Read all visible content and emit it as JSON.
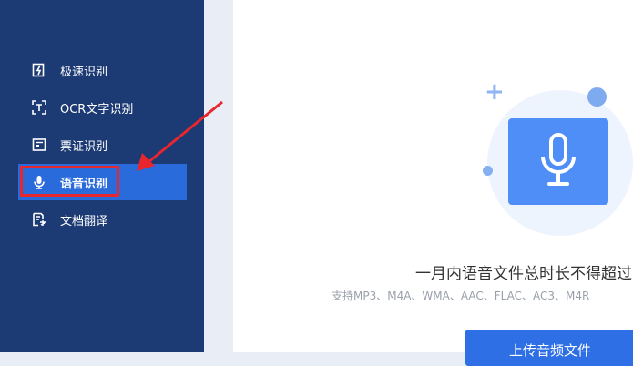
{
  "sidebar": {
    "items": [
      {
        "label": "极速识别",
        "icon": "lightning-doc-icon"
      },
      {
        "label": "OCR文字识别",
        "icon": "scan-text-icon"
      },
      {
        "label": "票证识别",
        "icon": "ticket-icon"
      },
      {
        "label": "语音识别",
        "icon": "microphone-icon",
        "active": true
      },
      {
        "label": "文档翻译",
        "icon": "doc-translate-icon"
      }
    ]
  },
  "main": {
    "title": "一月内语音文件总时长不得超过",
    "formats": "支持MP3、M4A、WMA、AAC、FLAC、AC3、M4R",
    "upload_label": "上传音频文件"
  },
  "colors": {
    "sidebar_bg": "#1c3a73",
    "active_item": "#2a6bdc",
    "highlight": "#e8262d",
    "accent": "#4f8ef7"
  }
}
